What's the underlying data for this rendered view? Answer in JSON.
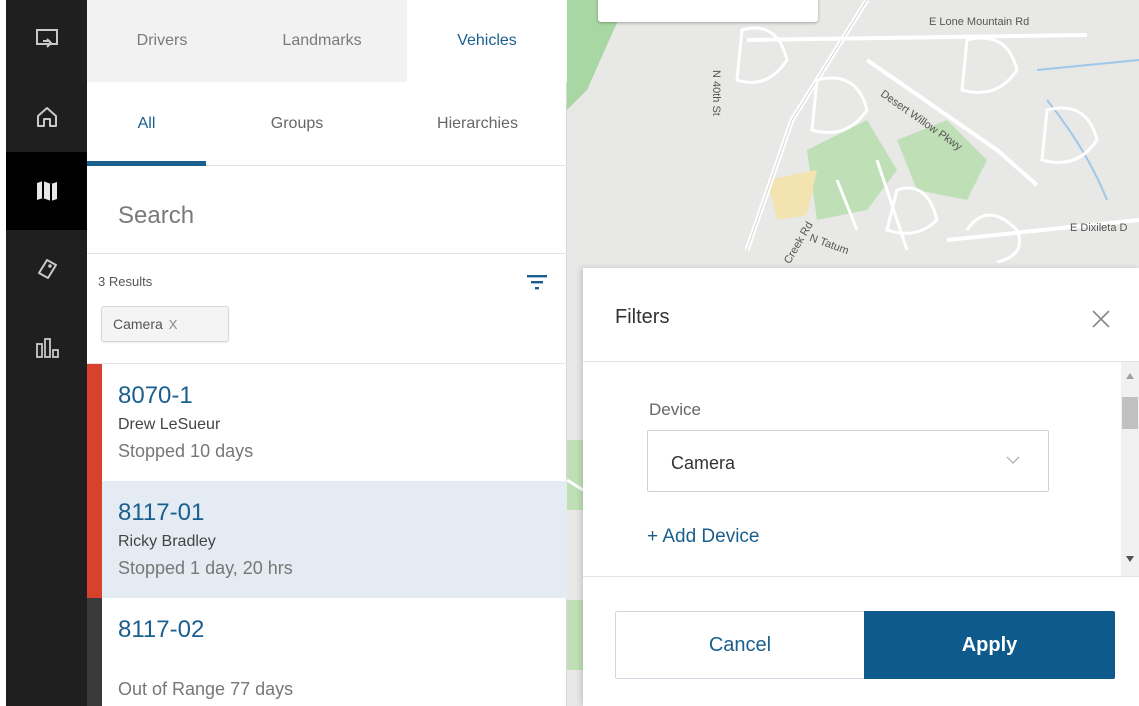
{
  "rail": {
    "icons": [
      "screen-share-icon",
      "home-icon",
      "map-icon",
      "alert-tag-icon",
      "reports-chart-icon"
    ],
    "active": "map-icon"
  },
  "panel": {
    "top_tabs": [
      {
        "label": "Drivers"
      },
      {
        "label": "Landmarks"
      },
      {
        "label": "Vehicles"
      }
    ],
    "active_top_tab": "Vehicles",
    "sub_tabs": [
      {
        "label": "All"
      },
      {
        "label": "Groups"
      },
      {
        "label": "Hierarchies"
      }
    ],
    "active_sub_tab": "All",
    "search": {
      "placeholder": "Search",
      "value": ""
    },
    "results_label": "3 Results",
    "chip": {
      "label": "Camera",
      "remove": "X"
    },
    "vehicles": [
      {
        "id": "8070-1",
        "driver": "Drew LeSueur",
        "status": "Stopped 10 days",
        "status_color": "#d8412b",
        "selected": false
      },
      {
        "id": "8117-01",
        "driver": "Ricky Bradley",
        "status": "Stopped 1 day, 20 hrs",
        "status_color": "#d8412b",
        "selected": true
      },
      {
        "id": "8117-02",
        "driver": "",
        "status": "Out of Range 77 days",
        "status_color": "#3a3a3a",
        "selected": false
      }
    ]
  },
  "map": {
    "labels": [
      "E Lone Mountain Rd",
      "N 40th St",
      "Desert Willow Pkwy",
      "E Dixileta D",
      "N Tatum",
      "Creek Rd"
    ]
  },
  "filters": {
    "title": "Filters",
    "device_label": "Device",
    "device_value": "Camera",
    "add_device": "+ Add Device",
    "cancel": "Cancel",
    "apply": "Apply"
  },
  "colors": {
    "accent": "#1a5f8e",
    "apply_bg": "#0f5a8c",
    "rail_bg": "#1f1f1f",
    "selected_row": "#e4ebf2",
    "status_red": "#d8412b"
  }
}
